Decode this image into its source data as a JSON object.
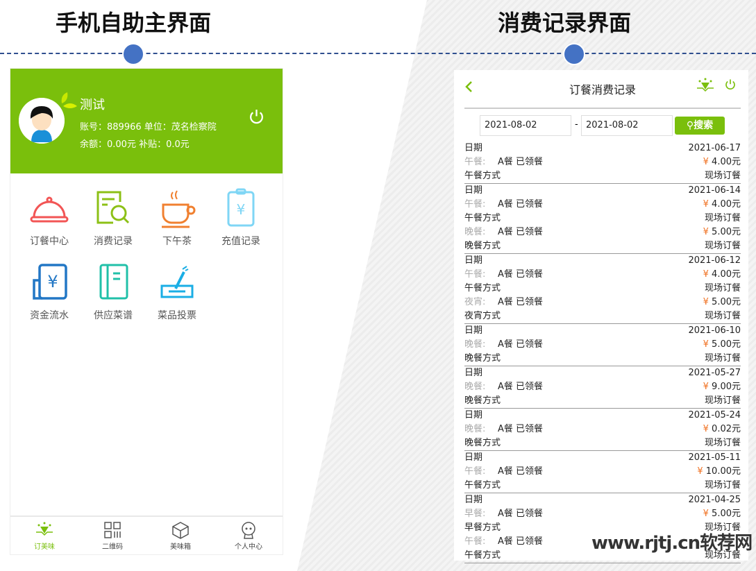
{
  "slides": {
    "left_title": "手机自助主界面",
    "right_title": "消费记录界面"
  },
  "home": {
    "user_name": "测试",
    "account_line": "账号：889966  单位：茂名检察院",
    "balance_line": "余额：0.00元  补贴：0.0元",
    "menu": [
      {
        "label": "订餐中心",
        "icon": "food-cloche-icon",
        "color": "#f25555"
      },
      {
        "label": "消费记录",
        "icon": "document-search-icon",
        "color": "#8cc016"
      },
      {
        "label": "下午茶",
        "icon": "coffee-cup-icon",
        "color": "#f08030"
      },
      {
        "label": "充值记录",
        "icon": "yen-clipboard-icon",
        "color": "#7fd6f5"
      },
      {
        "label": "资金流水",
        "icon": "yen-ledger-icon",
        "color": "#2277c5"
      },
      {
        "label": "供应菜谱",
        "icon": "menu-book-icon",
        "color": "#20c0a8"
      },
      {
        "label": "菜品投票",
        "icon": "vote-box-icon",
        "color": "#1aaee5"
      }
    ],
    "nav": [
      {
        "label": "订美味",
        "active": true
      },
      {
        "label": "二维码"
      },
      {
        "label": "美味箱"
      },
      {
        "label": "个人中心"
      }
    ]
  },
  "records": {
    "title": "订餐消费记录",
    "start_date": "2021-08-02",
    "end_date": "2021-08-02",
    "separator": "-",
    "search_label": "搜索",
    "date_label": "日期",
    "groups": [
      {
        "date": "2021-06-17",
        "items": [
          {
            "meal": "午餐:",
            "dish": "A餐 已领餐",
            "price": "4.00元",
            "method_label": "午餐方式",
            "method": "现场订餐"
          }
        ]
      },
      {
        "date": "2021-06-14",
        "items": [
          {
            "meal": "午餐:",
            "dish": "A餐 已领餐",
            "price": "4.00元",
            "method_label": "午餐方式",
            "method": "现场订餐"
          },
          {
            "meal": "晚餐:",
            "dish": "A餐 已领餐",
            "price": "5.00元",
            "method_label": "晚餐方式",
            "method": "现场订餐"
          }
        ]
      },
      {
        "date": "2021-06-12",
        "items": [
          {
            "meal": "午餐:",
            "dish": "A餐 已领餐",
            "price": "4.00元",
            "method_label": "午餐方式",
            "method": "现场订餐"
          },
          {
            "meal": "夜宵:",
            "dish": "A餐 已领餐",
            "price": "5.00元",
            "method_label": "夜宵方式",
            "method": "现场订餐"
          }
        ]
      },
      {
        "date": "2021-06-10",
        "items": [
          {
            "meal": "晚餐:",
            "dish": "A餐 已领餐",
            "price": "5.00元",
            "method_label": "晚餐方式",
            "method": "现场订餐"
          }
        ]
      },
      {
        "date": "2021-05-27",
        "items": [
          {
            "meal": "晚餐:",
            "dish": "A餐 已领餐",
            "price": "9.00元",
            "method_label": "晚餐方式",
            "method": "现场订餐"
          }
        ]
      },
      {
        "date": "2021-05-24",
        "items": [
          {
            "meal": "晚餐:",
            "dish": "A餐 已领餐",
            "price": "0.02元",
            "method_label": "晚餐方式",
            "method": "现场订餐"
          }
        ]
      },
      {
        "date": "2021-05-11",
        "items": [
          {
            "meal": "午餐:",
            "dish": "A餐 已领餐",
            "price": "10.00元",
            "method_label": "午餐方式",
            "method": "现场订餐"
          }
        ]
      },
      {
        "date": "2021-04-25",
        "items": [
          {
            "meal": "早餐:",
            "dish": "A餐 已领餐",
            "price": "5.00元",
            "method_label": "早餐方式",
            "method": "现场订餐"
          },
          {
            "meal": "午餐:",
            "dish": "A餐 已领餐",
            "price": "",
            "method_label": "午餐方式",
            "method": "现场订餐"
          }
        ]
      }
    ],
    "currency": "¥"
  },
  "watermark": "www.rjtj.cn软荐网"
}
